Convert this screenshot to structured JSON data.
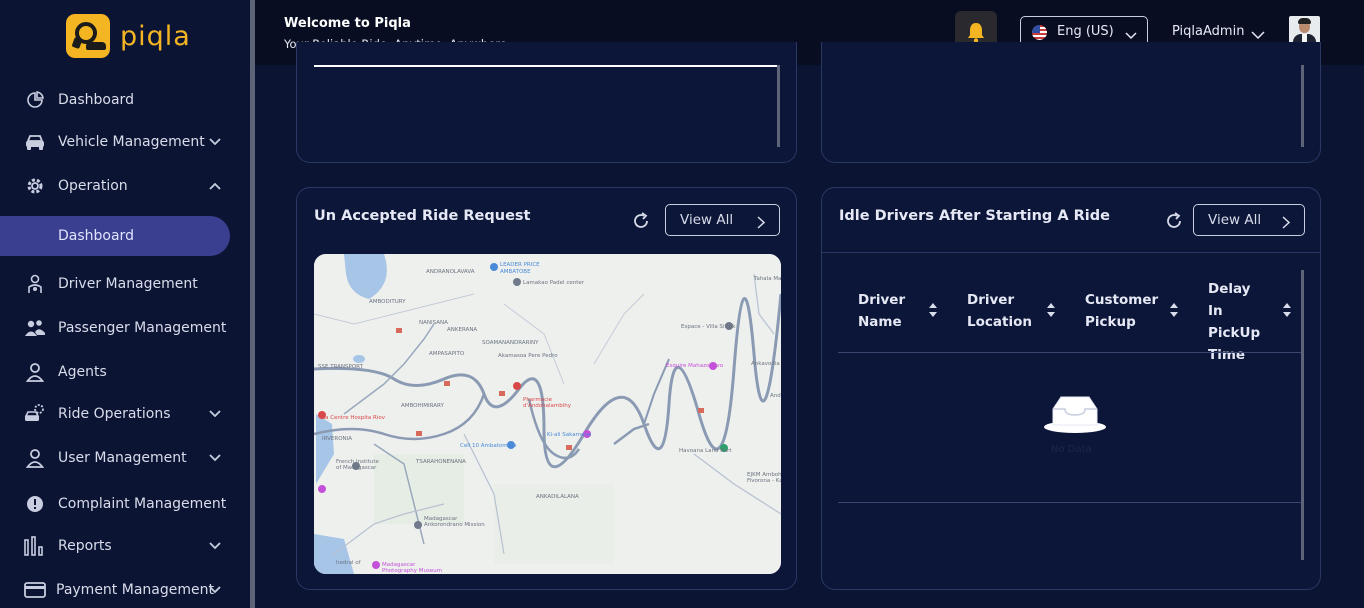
{
  "brand": {
    "name": "piqla",
    "color": "#f3b522"
  },
  "sidebar": {
    "items": [
      {
        "label": "Dashboard",
        "icon": "pie-chart-icon"
      },
      {
        "label": "Vehicle Management",
        "icon": "car-icon",
        "expandable": true
      },
      {
        "label": "Operation",
        "icon": "gear-icon",
        "expanded": true
      },
      {
        "label": "Dashboard",
        "icon": "",
        "active": true
      },
      {
        "label": "Driver Management",
        "icon": "driver-icon"
      },
      {
        "label": "Passenger Management",
        "icon": "users-icon"
      },
      {
        "label": "Agents",
        "icon": "person-icon"
      },
      {
        "label": "Ride Operations",
        "icon": "car-gear-icon",
        "expandable": true
      },
      {
        "label": "User Management",
        "icon": "person-icon",
        "expandable": true
      },
      {
        "label": "Complaint Management",
        "icon": "alert-circle-icon"
      },
      {
        "label": "Reports",
        "icon": "bar-chart-icon",
        "expandable": true
      },
      {
        "label": "Payment Management",
        "icon": "credit-card-icon",
        "expandable": true
      }
    ],
    "active_color": "#3b3f8f"
  },
  "header": {
    "welcome": "Welcome to Piqla",
    "tagline": "Your Reliable Ride, Anytime, Anywhere",
    "language": "Eng (US)",
    "user": "PiqlaAdmin",
    "bell_color": "#f3b522"
  },
  "unaccepted_card": {
    "title": "Un Accepted Ride Request",
    "view_all": "View All",
    "map_labels": [
      "ANDRANOLAVAVA",
      "LEADER PRICE AMBATOBE",
      "Lamakao Padel center",
      "AMBODITURY",
      "NANISANA",
      "ANKERANA",
      "SOAMANANDRARINY",
      "AMPASAPITO",
      "Akamasoa Pere Pedro",
      "Espace - Villa Sitrak",
      "Pharmacie d'Andohalambihy",
      "AMBOHIMIRARY",
      "Esquire Mahazoarivo",
      "Anka",
      "TSARAHONENANA",
      "Cell 10 Ambatomaro",
      "Ki-ali Sakamena",
      "Havoana Land Kart",
      "French Institute of Madagascar",
      "EJKM Ambohim Fivorona - Kar",
      "Madagascar Ankorondrano Mission",
      "Madagascar Photography Museum",
      "Tahala Malakhaana"
    ]
  },
  "idle_card": {
    "title": "Idle Drivers After Starting A Ride",
    "view_all": "View All",
    "columns": [
      "Driver Name",
      "Driver Location",
      "Customer Pickup",
      "Delay In PickUp Time"
    ],
    "empty_text": "No Data"
  }
}
